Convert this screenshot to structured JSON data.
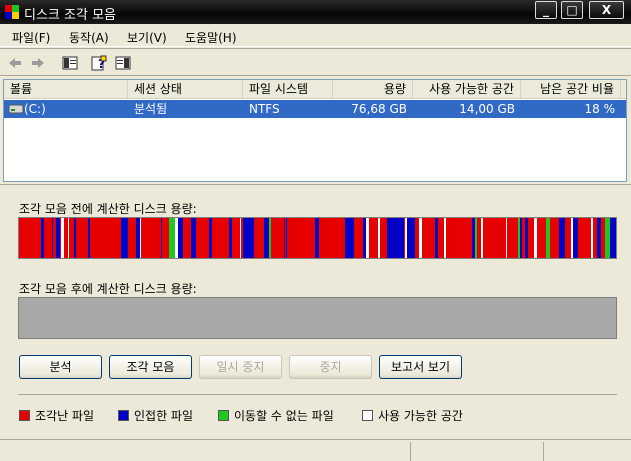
{
  "window": {
    "title": "디스크 조각 모음"
  },
  "window_controls": {
    "minimize": "_",
    "maximize": "□",
    "close": "X"
  },
  "menu": [
    "파일(F)",
    "동작(A)",
    "보기(V)",
    "도움말(H)"
  ],
  "toolbar": {
    "icons": [
      "back-arrow-icon",
      "forward-arrow-icon",
      "show-hide-tree-icon",
      "help-icon",
      "properties-icon"
    ]
  },
  "columns": [
    "볼륨",
    "세션 상태",
    "파일 시스템",
    "용량",
    "사용 가능한 공간",
    "남은 공간 비율"
  ],
  "volumes": [
    {
      "name": "(C:)",
      "status": "분석됨",
      "fs": "NTFS",
      "capacity": "76,68 GB",
      "free": "14,00 GB",
      "pct": "18 %"
    }
  ],
  "before_label": "조각 모음 전에 계산한 디스크 용량:",
  "after_label": "조각 모음 후에 계산한 디스크 용량:",
  "buttons": {
    "analyze": "분석",
    "defrag": "조각 모음",
    "pause": "일시 중지",
    "stop": "중지",
    "report": "보고서 보기"
  },
  "legend": {
    "fragmented": "조각난 파일",
    "contiguous": "인접한 파일",
    "unmovable": "이동할 수 없는 파일",
    "free": "사용 가능한 공간"
  },
  "colors": {
    "fragmented": "#e60000",
    "contiguous": "#0000c8",
    "unmovable": "#1ec81e",
    "free": "#ffffff",
    "selection": "#316ac5"
  }
}
